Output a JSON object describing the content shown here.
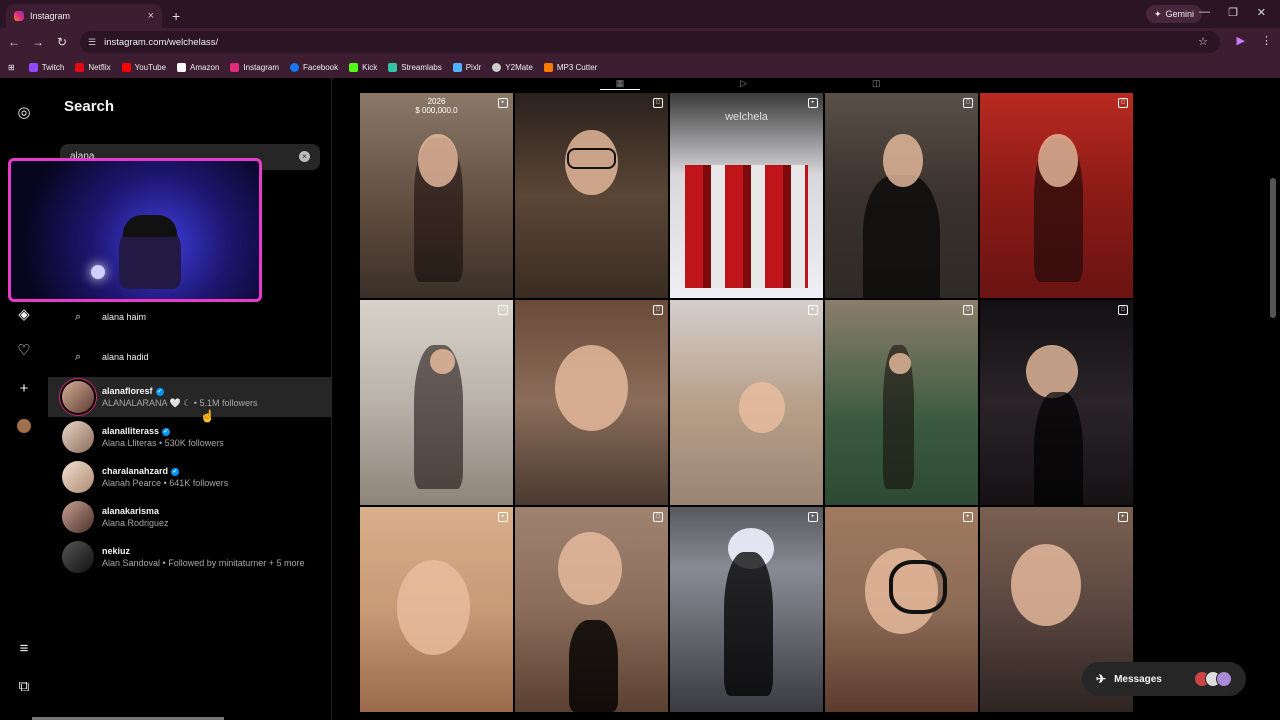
{
  "browser": {
    "tab_title": "Instagram",
    "tab_close": "×",
    "new_tab": "+",
    "gemini_label": "Gemini",
    "url": "instagram.com/welchelass/",
    "bookmarks": [
      "Twitch",
      "Netflix",
      "YouTube",
      "Amazon",
      "Instagram",
      "Facebook",
      "Kick",
      "Streamlabs",
      "Pixlr",
      "Y2Mate",
      "MP3 Cutter"
    ],
    "bookmark_colors": [
      "#9146ff",
      "#e50914",
      "#ff0000",
      "#ffffff",
      "#dd2a7b",
      "#1877f2",
      "#53fc18",
      "#31c3a2",
      "#4fb2ff",
      "#cccccc",
      "#ff7a00"
    ]
  },
  "sidebar": {
    "search_title": "Search",
    "search_value": "alana",
    "clear_icon": "×"
  },
  "suggestions": [
    {
      "text": "alana haim"
    },
    {
      "text": "alana hadid"
    }
  ],
  "accounts": [
    {
      "username": "alanafloresf",
      "verified": true,
      "subtitle": "ALANALARANA 🤍 ☾ • 5.1M followers",
      "highlighted": true
    },
    {
      "username": "alanalliterass",
      "verified": true,
      "subtitle": "Alana Lliteras • 530K followers",
      "highlighted": false
    },
    {
      "username": "charalanahzard",
      "verified": true,
      "subtitle": "Alanah Pearce • 641K followers",
      "highlighted": false
    },
    {
      "username": "alanakarisma",
      "verified": false,
      "subtitle": "Alana Rodriguez",
      "highlighted": false
    },
    {
      "username": "nekiuz",
      "verified": false,
      "subtitle": "Alan Sandoval • Followed by minitaturner + 5 more",
      "highlighted": false
    }
  ],
  "grid": {
    "first_tile_caption_line1": "2026",
    "first_tile_caption_line2": "$ 000,000.0",
    "minecraft_caption": "welchela",
    "tile_colors": [
      "#6d5a4b",
      "#4a3a30",
      "#c9c4c7",
      "#3c3732",
      "#8a1c1c",
      "#b9b2a9",
      "#7a5a48",
      "#b8a08a",
      "#4c4a3a",
      "#1d1a1c",
      "#c89a76",
      "#8a6d5a",
      "#6d6c74",
      "#8c6b55",
      "#5a4640"
    ]
  },
  "messages": {
    "label": "Messages"
  },
  "colors": {
    "accent_pink": "#e63bc8",
    "verified_blue": "#0095f6",
    "highlight_row": "#262626"
  }
}
